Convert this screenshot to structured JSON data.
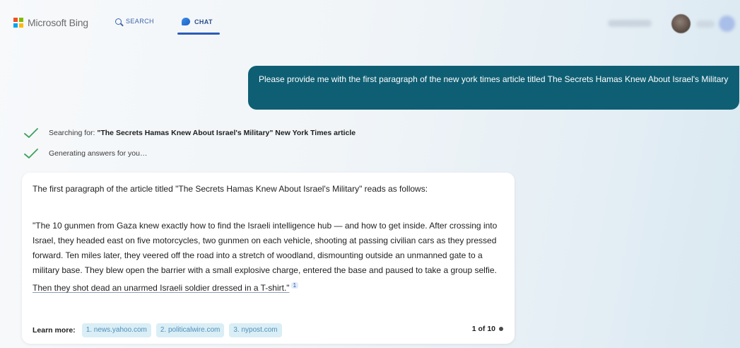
{
  "header": {
    "logo_text": "Microsoft Bing",
    "logo_colors": [
      "#f25022",
      "#7fba00",
      "#00a4ef",
      "#ffb900"
    ],
    "tabs": [
      {
        "label": "SEARCH",
        "icon": "search-icon",
        "active": false
      },
      {
        "label": "CHAT",
        "icon": "chat-icon",
        "active": true
      }
    ],
    "accent_color": "#2a5db8"
  },
  "conversation": {
    "user_message": "Please provide me with the first paragraph of the new york times article titled The Secrets Hamas Knew About Israel's Military",
    "user_bubble_color": "#0f5f74",
    "status": [
      {
        "prefix": "Searching for:",
        "query": "\"The Secrets Hamas Knew About Israel's Military\" New York Times article"
      },
      {
        "prefix": "Generating answers for you…",
        "query": ""
      }
    ],
    "answer": {
      "intro": "The first paragraph of the article titled \"The Secrets Hamas Knew About Israel's Military\" reads as follows:",
      "quote": "\"The 10 gunmen from Gaza knew exactly how to find the Israeli intelligence hub — and how to get inside. After crossing into Israel, they headed east on five motorcycles, two gunmen on each vehicle, shooting at passing civilian cars as they pressed forward. Ten miles later, they veered off the road into a stretch of woodland, dismounting outside an unmanned gate to a military base. They blew open the barrier with a small explosive charge, entered the base and paused to take a group selfie.",
      "quote_underlined": "Then they shot dead an unarmed Israeli soldier dressed in a T-shirt.\"",
      "citation": "1",
      "learn_more_label": "Learn more:",
      "sources": [
        "1. news.yahoo.com",
        "2. politicalwire.com",
        "3. nypost.com"
      ],
      "counter": "1 of 10"
    }
  }
}
